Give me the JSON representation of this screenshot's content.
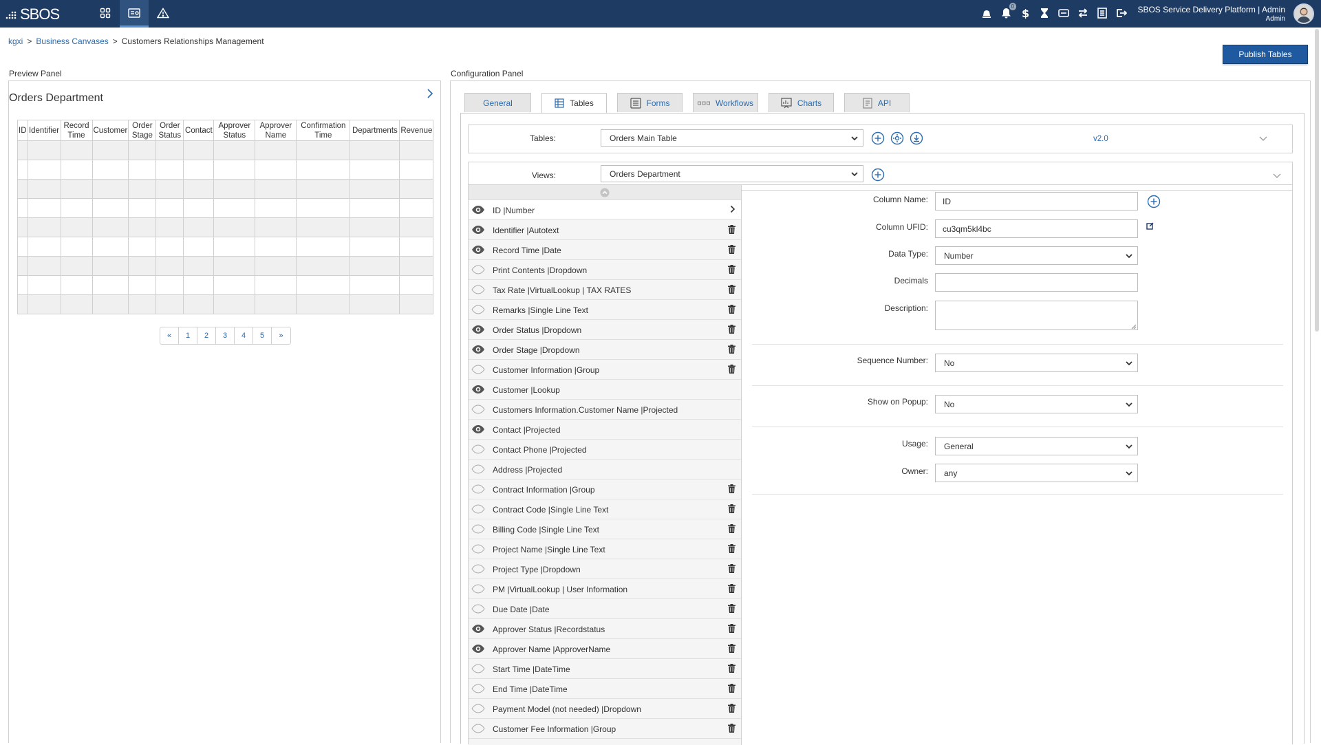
{
  "app": {
    "logo": "SBOS",
    "platform_title": "SBOS Service Delivery Platform | Admin",
    "platform_user": "Admin",
    "notification_count": "0"
  },
  "breadcrumb": [
    "kgxi",
    "Business Canvases",
    "Customers Relationships Management"
  ],
  "publish_label": "Publish Tables",
  "preview": {
    "panel_title": "Preview Panel",
    "heading": "Orders Department",
    "columns": [
      [
        "ID"
      ],
      [
        "Identifier"
      ],
      [
        "Record",
        "Time"
      ],
      [
        "Customer"
      ],
      [
        "Order",
        "Stage"
      ],
      [
        "Order",
        "Status"
      ],
      [
        "Contact"
      ],
      [
        "Approver",
        "Status"
      ],
      [
        "Approver",
        "Name"
      ],
      [
        "Confirmation",
        "Time"
      ],
      [
        "Departments"
      ],
      [
        "Revenue"
      ]
    ],
    "pager": [
      "«",
      "1",
      "2",
      "3",
      "4",
      "5",
      "»"
    ]
  },
  "config": {
    "panel_title": "Configuration Panel",
    "tabs": [
      "General",
      "Tables",
      "Forms",
      "Workflows",
      "Charts",
      "API"
    ],
    "active_tab": "Tables",
    "tables_label": "Tables:",
    "tables_value": "Orders Main Table",
    "version": "v2.0",
    "views_label": "Views:",
    "views_value": "Orders Department",
    "columns": [
      {
        "name": "ID |Number",
        "visible": true,
        "action": "chevron-right"
      },
      {
        "name": "Identifier |Autotext",
        "visible": true,
        "action": "trash"
      },
      {
        "name": "Record Time |Date",
        "visible": true,
        "action": "trash"
      },
      {
        "name": "Print Contents |Dropdown",
        "visible": false,
        "action": "trash"
      },
      {
        "name": "Tax Rate |VirtualLookup | TAX RATES",
        "visible": false,
        "action": "trash"
      },
      {
        "name": "Remarks |Single Line Text",
        "visible": false,
        "action": "trash"
      },
      {
        "name": "Order Status |Dropdown",
        "visible": true,
        "action": "trash"
      },
      {
        "name": "Order Stage |Dropdown",
        "visible": true,
        "action": "trash"
      },
      {
        "name": "Customer Information |Group",
        "visible": false,
        "action": "trash"
      },
      {
        "name": "Customer |Lookup",
        "visible": true,
        "action": "none"
      },
      {
        "name": "Customers Information.Customer Name |Projected",
        "visible": false,
        "action": "none"
      },
      {
        "name": "Contact |Projected",
        "visible": true,
        "action": "none"
      },
      {
        "name": "Contact Phone |Projected",
        "visible": false,
        "action": "none"
      },
      {
        "name": "Address |Projected",
        "visible": false,
        "action": "none"
      },
      {
        "name": "Contract Information |Group",
        "visible": false,
        "action": "trash"
      },
      {
        "name": "Contract Code |Single Line Text",
        "visible": false,
        "action": "trash"
      },
      {
        "name": "Billing Code |Single Line Text",
        "visible": false,
        "action": "trash"
      },
      {
        "name": "Project Name |Single Line Text",
        "visible": false,
        "action": "trash"
      },
      {
        "name": "Project Type |Dropdown",
        "visible": false,
        "action": "trash"
      },
      {
        "name": "PM |VirtualLookup | User Information",
        "visible": false,
        "action": "trash"
      },
      {
        "name": "Due Date |Date",
        "visible": false,
        "action": "trash"
      },
      {
        "name": "Approver Status |Recordstatus",
        "visible": true,
        "action": "trash"
      },
      {
        "name": "Approver Name |ApproverName",
        "visible": true,
        "action": "trash"
      },
      {
        "name": "Start Time |DateTime",
        "visible": false,
        "action": "trash"
      },
      {
        "name": "End Time |DateTime",
        "visible": false,
        "action": "trash"
      },
      {
        "name": "Payment Model (not needed) |Dropdown",
        "visible": false,
        "action": "trash"
      },
      {
        "name": "Customer Fee Information |Group",
        "visible": false,
        "action": "trash"
      }
    ],
    "form": {
      "column_name_label": "Column Name:",
      "column_name_value": "ID",
      "column_ufid_label": "Column UFID:",
      "column_ufid_value": "cu3qm5kl4bc",
      "data_type_label": "Data Type:",
      "data_type_value": "Number",
      "decimals_label": "Decimals",
      "decimals_value": "",
      "description_label": "Description:",
      "description_value": "",
      "sequence_label": "Sequence Number:",
      "sequence_value": "No",
      "popup_label": "Show on Popup:",
      "popup_value": "No",
      "usage_label": "Usage:",
      "usage_value": "General",
      "owner_label": "Owner:",
      "owner_value": "any"
    }
  }
}
